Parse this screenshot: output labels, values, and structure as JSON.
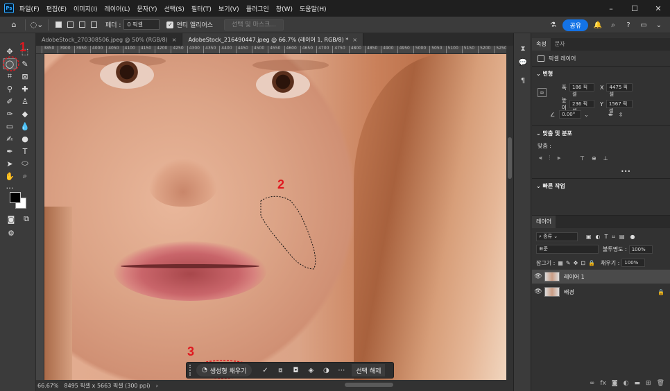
{
  "app": {
    "logo_text": "Ps"
  },
  "menu": [
    "파일(F)",
    "편집(E)",
    "이미지(I)",
    "레이어(L)",
    "문자(Y)",
    "선택(S)",
    "필터(T)",
    "보기(V)",
    "플러그인",
    "창(W)",
    "도움말(H)"
  ],
  "options_bar": {
    "feather_label": "페더 :",
    "feather_value": "0 픽셀",
    "antialias_label": "앤티 앨리어스",
    "select_mask_label": "선택 및 마스크...",
    "share_label": "공유"
  },
  "tabs": [
    {
      "label": "AdobeStock_270308506.jpeg @ 50% (RGB/8)",
      "close": "×"
    },
    {
      "label": "AdobeStock_216490447.jpeg @ 66.7% (레이어 1, RGB/8) *",
      "close": "×"
    }
  ],
  "ruler_h": [
    "3850",
    "3900",
    "3950",
    "4000",
    "4050",
    "4100",
    "4150",
    "4200",
    "4250",
    "4300",
    "4350",
    "4400",
    "4450",
    "4500",
    "4550",
    "4600",
    "4650",
    "4700",
    "4750",
    "4800",
    "4850",
    "4900",
    "4950",
    "5000",
    "5050",
    "5100",
    "5150",
    "5200",
    "5250"
  ],
  "contextual_bar": {
    "generative_fill_label": "생성형 채우기",
    "deselect_label": "선택 해제"
  },
  "status": {
    "zoom": "66.67%",
    "doc_info": "8495 픽셀 x 5663 픽셀 (300 ppi)",
    "arrow": "›"
  },
  "properties": {
    "tabs": [
      "속성",
      "문자"
    ],
    "layer_type": "픽셀 레이어",
    "transform_title": "변형",
    "width_label": "폭",
    "width_value": "186 픽셀",
    "height_label": "높이",
    "height_value": "236 픽셀",
    "x_label": "X",
    "x_value": "4475 픽셀",
    "y_label": "Y",
    "y_value": "1567 픽셀",
    "angle_value": "0.00°",
    "align_title": "맞춤 및 분포",
    "align_label": "맞춤 :",
    "quick_actions_title": "빠른 작업",
    "more": "•••"
  },
  "layers_panel": {
    "tab": "레이어",
    "kind_label": "종류",
    "blend_mode": "표준",
    "opacity_label": "불투명도 :",
    "opacity_value": "100%",
    "lock_label": "잠그기 :",
    "fill_label": "채우기 :",
    "fill_value": "100%",
    "layers": [
      {
        "name": "레이어 1",
        "active": true
      },
      {
        "name": "배경",
        "active": false
      }
    ]
  },
  "annotations": {
    "one": "1",
    "two": "2",
    "three": "3"
  }
}
